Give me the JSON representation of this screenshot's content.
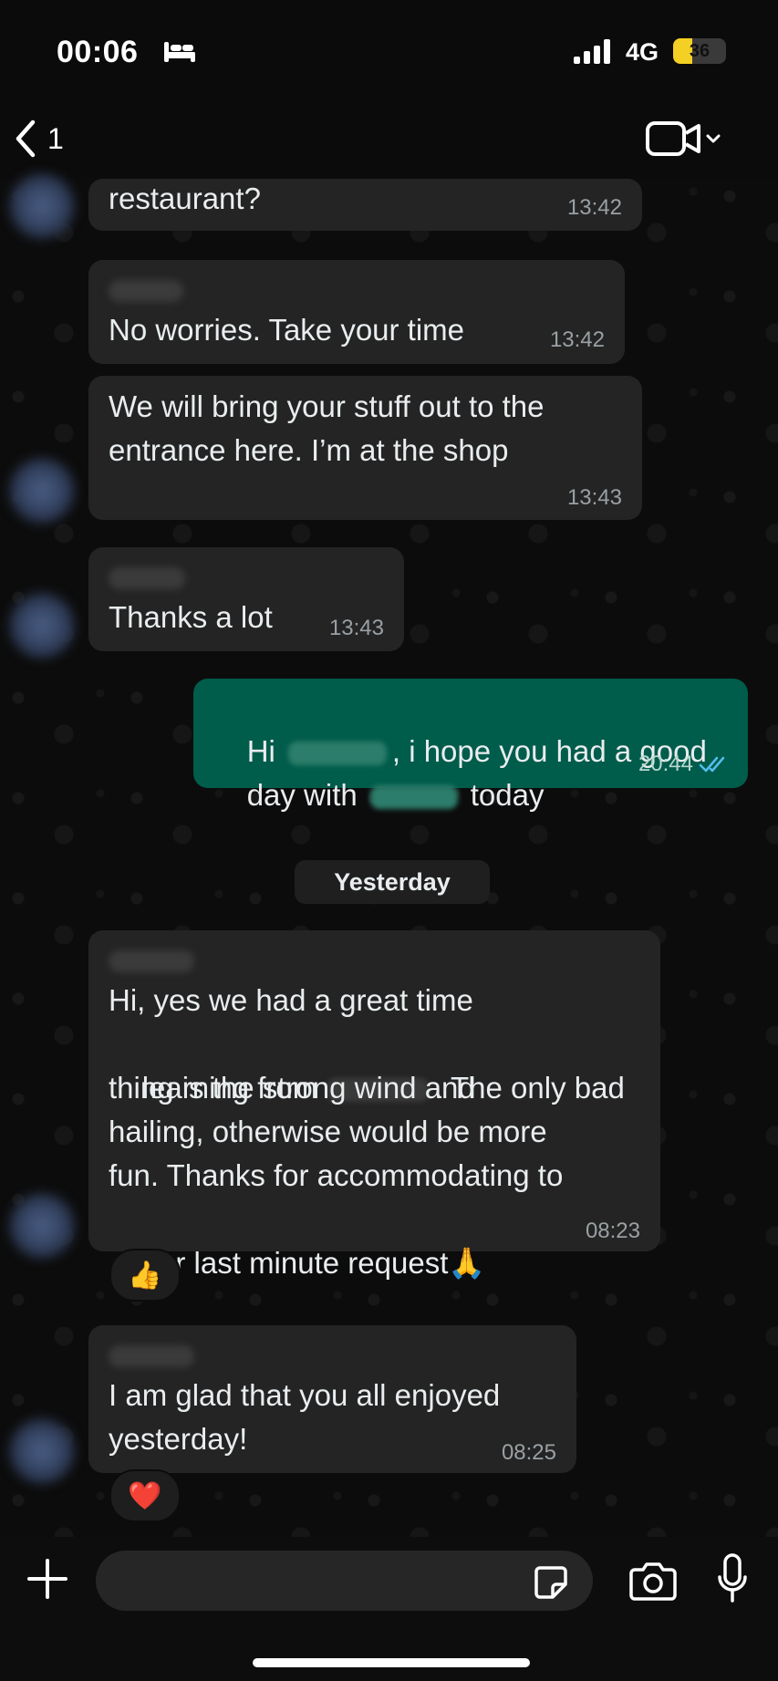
{
  "status_bar": {
    "time": "00:06",
    "network": "4G",
    "battery_text": "36",
    "battery_level": 0.36,
    "battery_color": "#f5d024",
    "icons": [
      "bed-icon",
      "signal-bars-icon",
      "battery-icon"
    ]
  },
  "header": {
    "back_count": "1",
    "icons": [
      "chevron-left-icon",
      "video-camera-icon",
      "chevron-down-icon"
    ]
  },
  "messages": [
    {
      "direction": "incoming",
      "text": "restaurant?",
      "time": "13:42"
    },
    {
      "direction": "incoming",
      "text": "No worries. Take your time",
      "time": "13:42"
    },
    {
      "direction": "incoming",
      "line1": "We will bring your stuff out to the",
      "line2": "entrance here. I’m at the shop",
      "time": "13:43"
    },
    {
      "direction": "incoming",
      "text": "Thanks a lot",
      "time": "13:43"
    },
    {
      "direction": "outgoing",
      "line1_a": "Hi",
      "line1_b": ", i hope you had a good",
      "line2_a": "day with",
      "line2_b": "today",
      "time": "20:44",
      "status_icon": "double-check-read-icon",
      "read_color": "#53bdeb"
    },
    {
      "direction": "incoming",
      "line1": "Hi, yes we had a great time",
      "line2_a": "learning from",
      "line2_b": ". The only bad",
      "line3": "thing is the strong wind and",
      "line4": "hailing, otherwise would be more",
      "line5": "fun. Thanks for accommodating to",
      "line6": "our last minute request",
      "emoji": "🙏",
      "time": "08:23",
      "reaction": "👍"
    },
    {
      "direction": "incoming",
      "line1": "I am glad that you all enjoyed",
      "line2": "yesterday!",
      "time": "08:25",
      "reaction": "❤️"
    }
  ],
  "date_separator": "Yesterday",
  "colors": {
    "incoming_bubble": "#242424",
    "outgoing_bubble": "#005c4b",
    "background": "#0b0b0b"
  },
  "input_bar": {
    "placeholder": "",
    "icons": [
      "plus-icon",
      "sticker-icon",
      "camera-icon",
      "microphone-icon"
    ]
  }
}
